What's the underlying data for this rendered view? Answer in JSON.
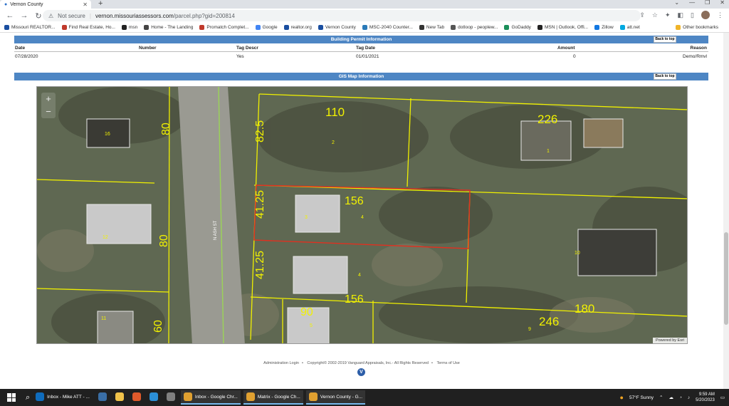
{
  "browser": {
    "tab_title": "Vernon County",
    "url_warning": "Not secure",
    "url_host": "vernon.missouriassessors.com",
    "url_path": "/parcel.php?gid=200814",
    "bookmarks": [
      {
        "label": "Missouri REALTOR...",
        "color": "#1a4ea0"
      },
      {
        "label": "Find Real Estate, Ho...",
        "color": "#c0392b"
      },
      {
        "label": "msn",
        "color": "#222222"
      },
      {
        "label": "Home - The Landing",
        "color": "#444444"
      },
      {
        "label": "Promatch Complet...",
        "color": "#c0392b"
      },
      {
        "label": "Google",
        "color": "#4285f4"
      },
      {
        "label": "realtor.org",
        "color": "#1a4ea0"
      },
      {
        "label": "Vernon County",
        "color": "#1a4ea0"
      },
      {
        "label": "MSC-2040 Counter...",
        "color": "#2a7ab8"
      },
      {
        "label": "New Tab",
        "color": "#333333"
      },
      {
        "label": "dotloop - peoplew...",
        "color": "#555555"
      },
      {
        "label": "GoDaddy",
        "color": "#1b8f5a"
      },
      {
        "label": "MSN | Outlook, Offi...",
        "color": "#222222"
      },
      {
        "label": "Zillow",
        "color": "#1277e1"
      },
      {
        "label": "att.net",
        "color": "#00a8e0"
      }
    ],
    "other_bookmarks": "Other bookmarks"
  },
  "permit": {
    "title": "Building Permit Information",
    "back_to_top": "Back to top",
    "headers": [
      "Date",
      "Number",
      "Tag Descr",
      "Tag Date",
      "Amount",
      "Reason"
    ],
    "row": [
      "07/28/2020",
      "",
      "Yes",
      "01/01/2021",
      "0",
      "Demo/Rmvl"
    ]
  },
  "gis": {
    "title": "GIS Map Information",
    "back_to_top": "Back to top",
    "zoom_in": "+",
    "zoom_out": "−",
    "street": "N ASH ST",
    "dims": [
      "110",
      "226",
      "82.5",
      "80",
      "156",
      "41.25",
      "80",
      "41.25",
      "156",
      "90",
      "180",
      "246",
      "60"
    ],
    "lots": [
      "16",
      "2",
      "1",
      "3",
      "4",
      "10",
      "12",
      "4",
      "11",
      "5",
      "9"
    ],
    "attribution": "Powered by Esri"
  },
  "footer": {
    "admin": "Administration Login",
    "copyright": "Copyright© 2002-2019 Vanguard Appraisals, Inc.- All Rights Reserved",
    "terms": "Terms of Use",
    "logo": "V"
  },
  "taskbar": {
    "apps": [
      {
        "label": "Inbox - Mike ATT - ...",
        "color": "#0f6cbd",
        "active": false
      },
      {
        "label": "",
        "color": "#3a6ea5",
        "active": false
      },
      {
        "label": "",
        "color": "#f0c24a",
        "active": false
      },
      {
        "label": "",
        "color": "#e05a2b",
        "active": false
      },
      {
        "label": "",
        "color": "#2b8fd6",
        "active": false
      },
      {
        "label": "",
        "color": "#7f7f7f",
        "active": false
      },
      {
        "label": "Inbox - Google Chr...",
        "color": "#e0a030",
        "active": true
      },
      {
        "label": "Matrix - Google Ch...",
        "color": "#e0a030",
        "active": true
      },
      {
        "label": "Vernon County - G...",
        "color": "#e0a030",
        "active": true
      }
    ],
    "weather": "57°F  Sunny",
    "time": "9:59 AM",
    "date": "5/20/2023"
  }
}
